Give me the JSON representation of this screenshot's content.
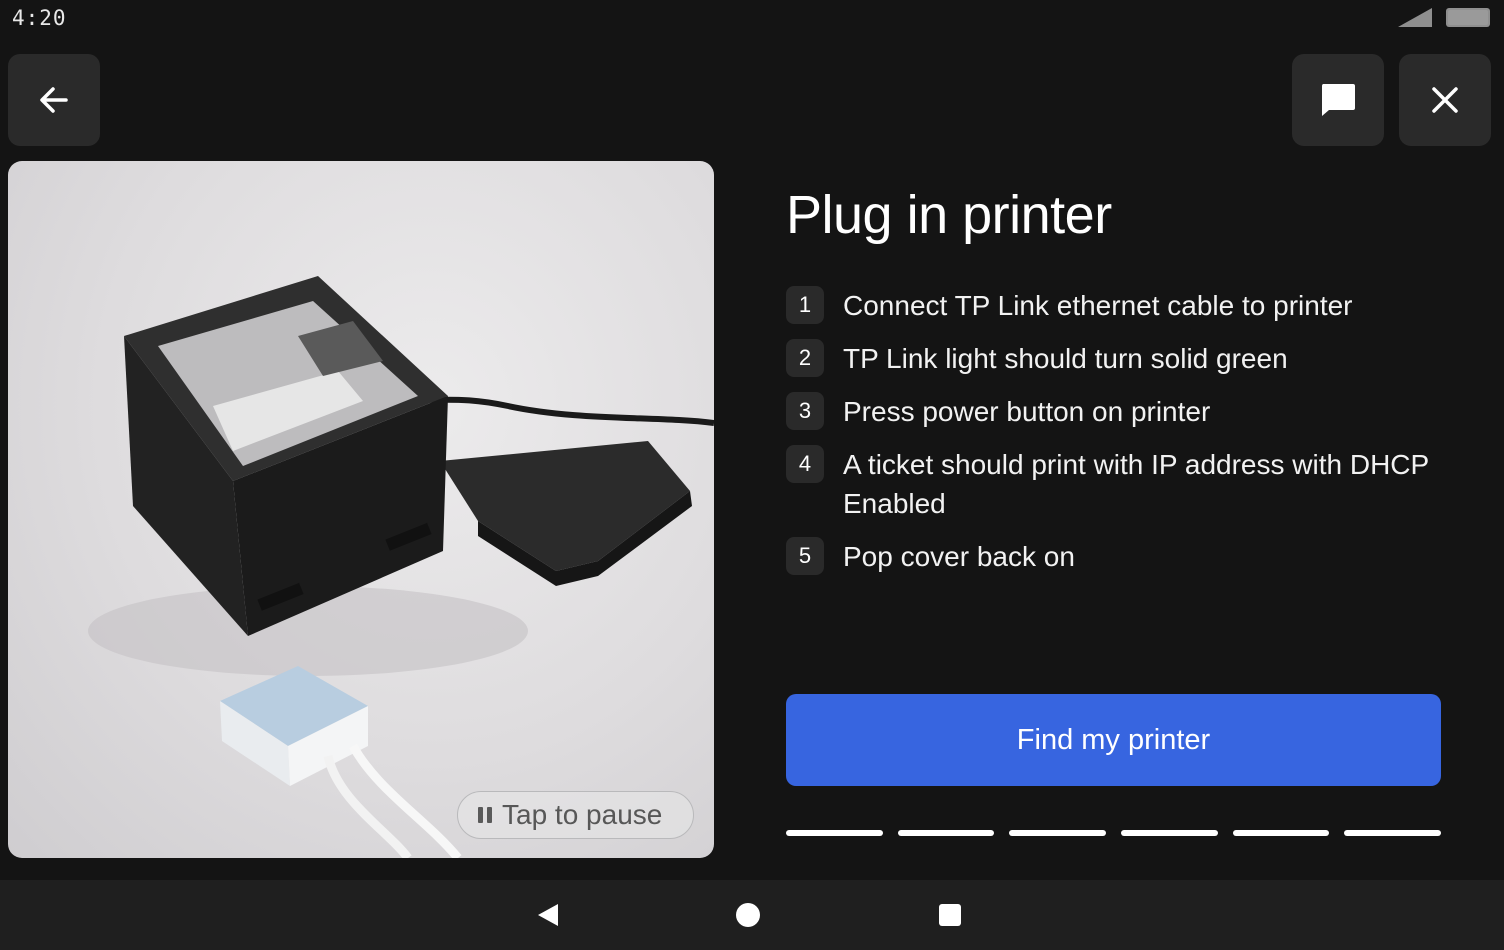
{
  "status_bar": {
    "time": "4:20",
    "icons": [
      "signal-icon",
      "battery-icon"
    ]
  },
  "header": {
    "buttons": [
      "back-arrow-icon",
      "chat-icon",
      "close-icon"
    ]
  },
  "media": {
    "pause_label": "Tap to pause"
  },
  "main": {
    "title": "Plug in printer",
    "steps": [
      {
        "number": "1",
        "text": "Connect TP Link ethernet cable to printer"
      },
      {
        "number": "2",
        "text": "TP Link light should turn solid green"
      },
      {
        "number": "3",
        "text": "Press power button on printer"
      },
      {
        "number": "4",
        "text": "A ticket should print with IP address with DHCP Enabled"
      },
      {
        "number": "5",
        "text": "Pop cover back on"
      }
    ],
    "primary_button": "Find my printer",
    "progress_total_segments": 6,
    "progress_filled_segments": 6
  },
  "colors": {
    "background": "#141414",
    "button_bg": "#2a2a2a",
    "primary": "#3765e0",
    "navbar": "#1f1f1f"
  }
}
